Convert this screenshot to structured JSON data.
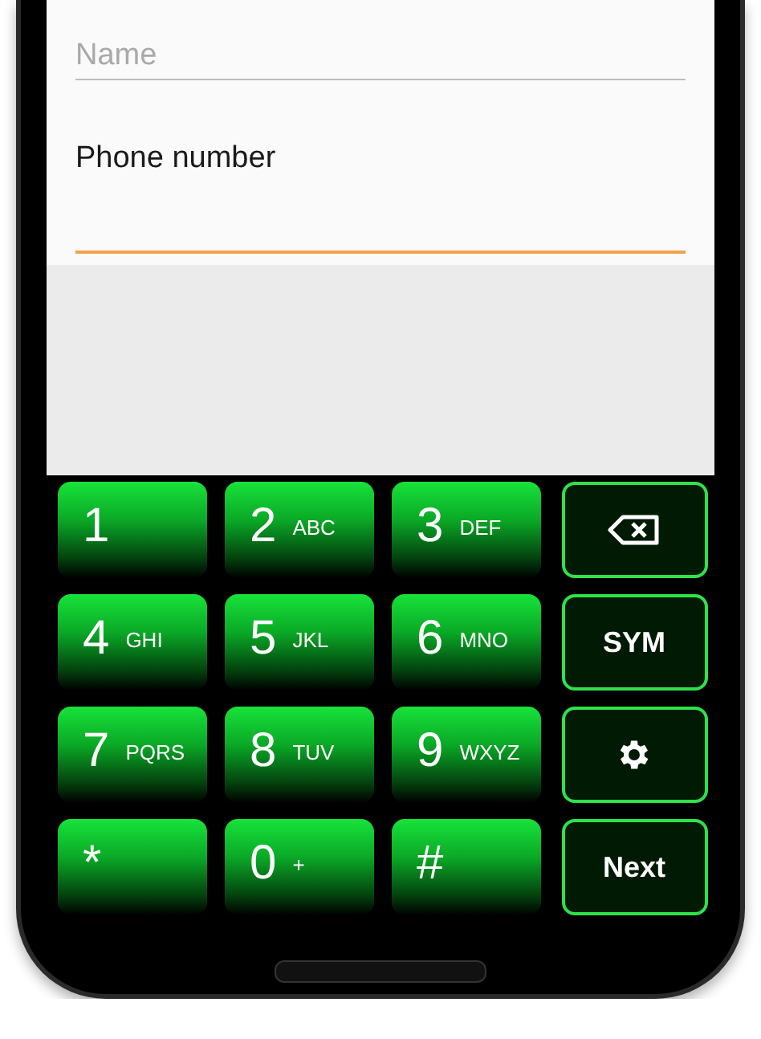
{
  "form": {
    "fields": [
      {
        "placeholder": "Name",
        "focused": false
      },
      {
        "label": "Phone number",
        "focused": true
      }
    ]
  },
  "keypad": {
    "keys": [
      {
        "kind": "digit",
        "digit": "1"
      },
      {
        "kind": "digit",
        "digit": "2",
        "letters": "ABC"
      },
      {
        "kind": "digit",
        "digit": "3",
        "letters": "DEF"
      },
      {
        "kind": "backspace"
      },
      {
        "kind": "digit",
        "digit": "4",
        "letters": "GHI"
      },
      {
        "kind": "digit",
        "digit": "5",
        "letters": "JKL"
      },
      {
        "kind": "digit",
        "digit": "6",
        "letters": "MNO"
      },
      {
        "kind": "action",
        "label": "SYM"
      },
      {
        "kind": "digit",
        "digit": "7",
        "letters": "PQRS"
      },
      {
        "kind": "digit",
        "digit": "8",
        "letters": "TUV"
      },
      {
        "kind": "digit",
        "digit": "9",
        "letters": "WXYZ"
      },
      {
        "kind": "settings"
      },
      {
        "kind": "digit",
        "digit": "*"
      },
      {
        "kind": "digit",
        "digit": "0",
        "letters": "+"
      },
      {
        "kind": "digit",
        "digit": "#"
      },
      {
        "kind": "action",
        "label": "Next"
      }
    ]
  }
}
